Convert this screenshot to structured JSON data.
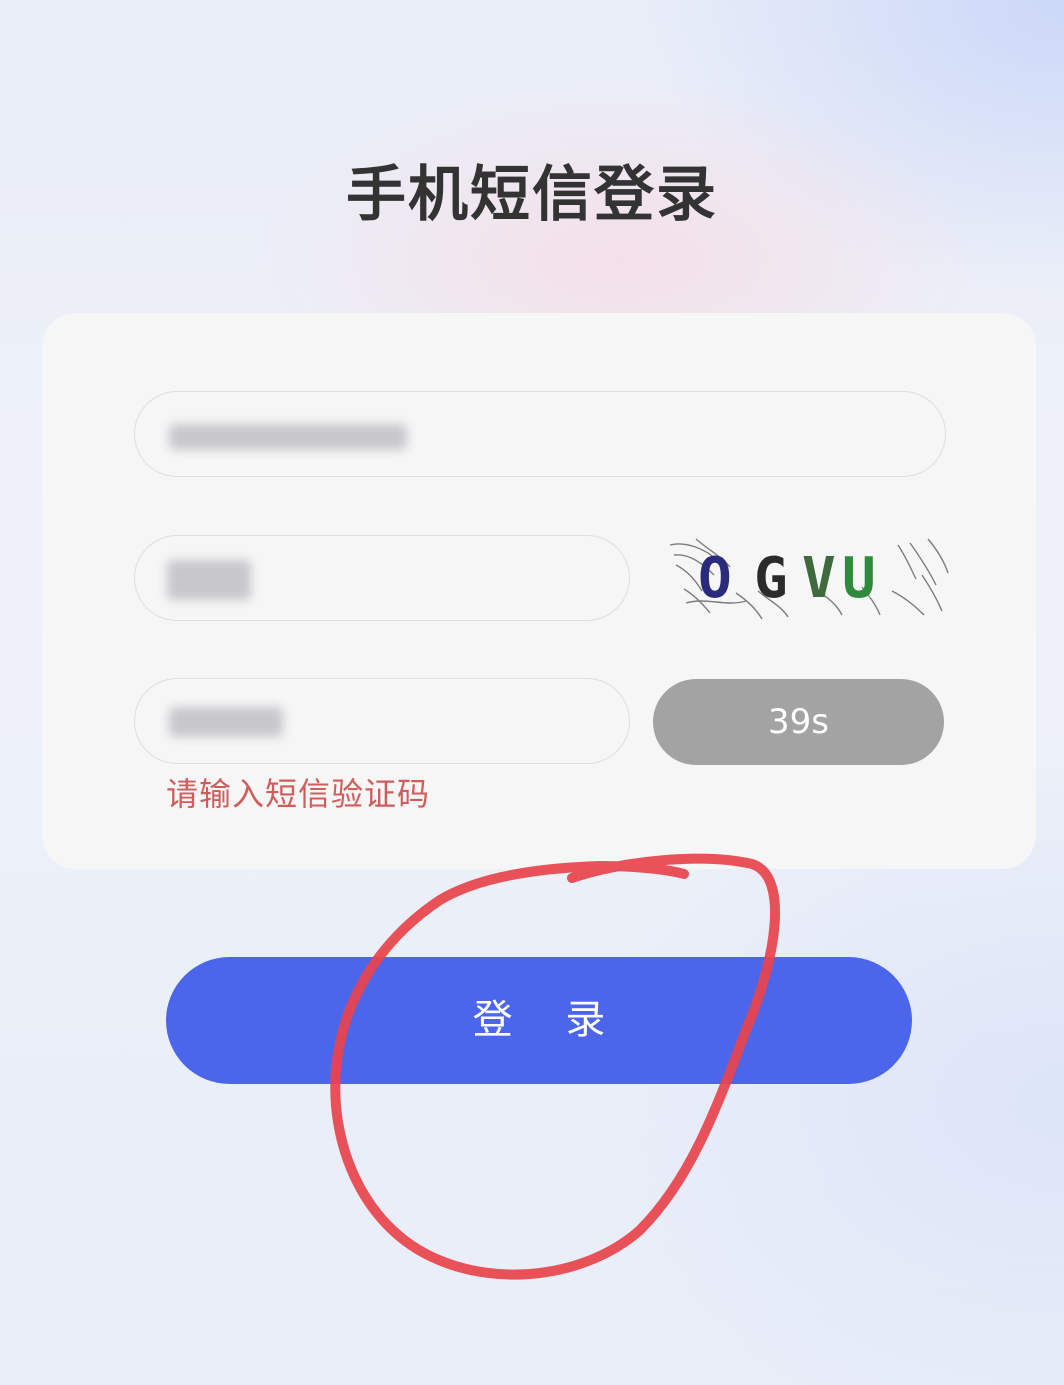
{
  "page": {
    "title": "手机短信登录"
  },
  "form": {
    "phone_field": {
      "value": "",
      "state": "blurred / redacted"
    },
    "captcha_field": {
      "value": "",
      "state": "blurred / redacted"
    },
    "captcha_image": {
      "text": "OGVU"
    },
    "sms_code_field": {
      "value": "",
      "state": "blurred / redacted"
    },
    "countdown_button": {
      "label": "39s"
    },
    "error_message": "请输入短信验证码"
  },
  "login_button": {
    "label": "登 录"
  },
  "colors": {
    "accent": "#4b66eb",
    "countdown_bg": "#a3a3a3",
    "error_text": "#d05c5c",
    "annotation": "#e8434b"
  }
}
